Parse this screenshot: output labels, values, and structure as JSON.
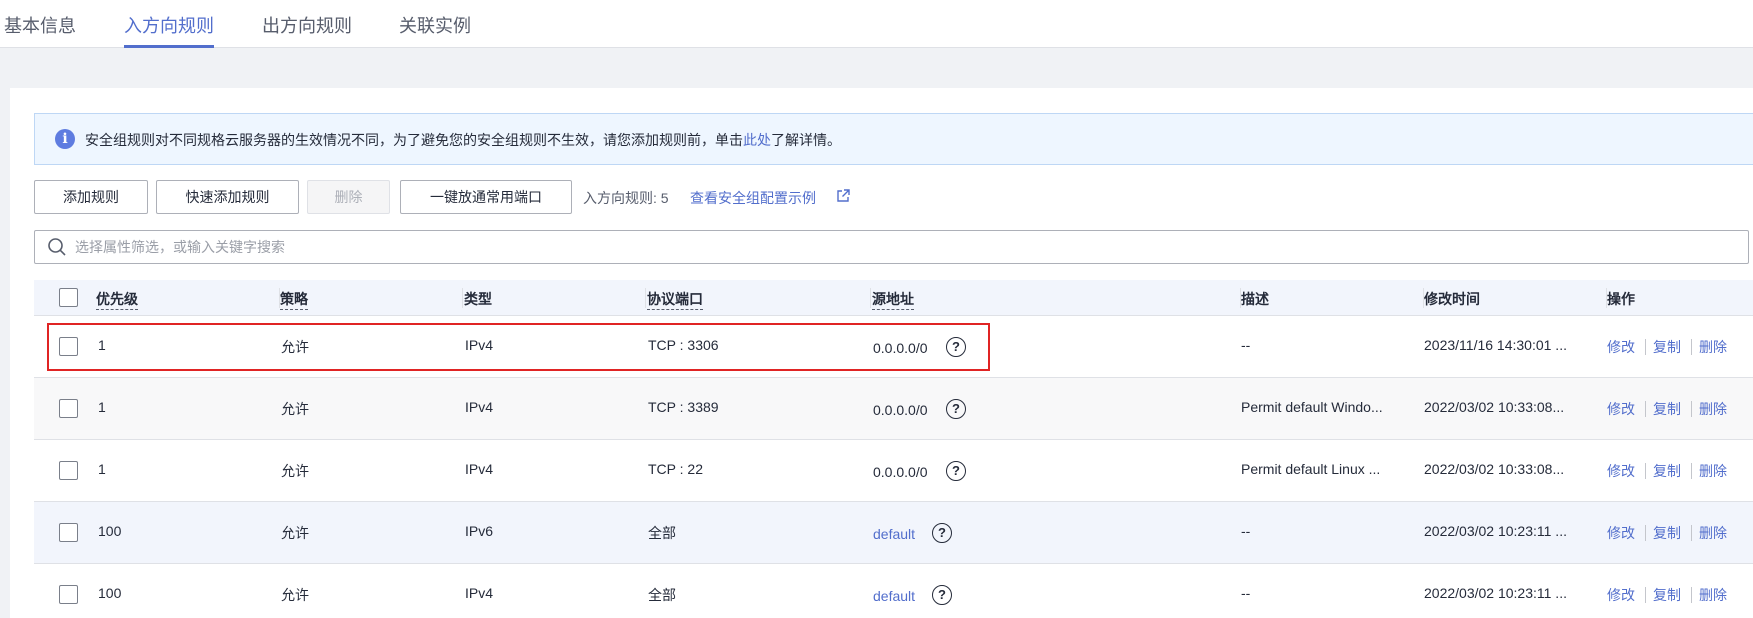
{
  "tabs": [
    {
      "label": "基本信息"
    },
    {
      "label": "入方向规则"
    },
    {
      "label": "出方向规则"
    },
    {
      "label": "关联实例"
    }
  ],
  "notice": {
    "icon": "info-icon",
    "text_before": "安全组规则对不同规格云服务器的生效情况不同，为了避免您的安全组规则不生效，请您添加规则前，单击",
    "link": "此处",
    "text_after": "了解详情。"
  },
  "toolbar": {
    "add_rule": "添加规则",
    "quick_add_rule": "快速添加规则",
    "delete": "删除",
    "open_common_ports": "一键放通常用端口",
    "rule_count": "入方向规则: 5",
    "config_example_link": "查看安全组配置示例"
  },
  "search": {
    "placeholder": "选择属性筛选，或输入关键字搜索"
  },
  "table": {
    "columns": {
      "priority": "优先级",
      "policy": "策略",
      "type": "类型",
      "protocol_port": "协议端口",
      "source": "源地址",
      "description": "描述",
      "modified": "修改时间",
      "actions": "操作"
    },
    "rows": [
      {
        "priority": "1",
        "policy": "允许",
        "type": "IPv4",
        "protocol_port": "TCP : 3306",
        "source": "0.0.0.0/0",
        "description": "--",
        "modified": "2023/11/16 14:30:01 ..."
      },
      {
        "priority": "1",
        "policy": "允许",
        "type": "IPv4",
        "protocol_port": "TCP : 3389",
        "source": "0.0.0.0/0",
        "description": "Permit default Windo...",
        "modified": "2022/03/02 10:33:08..."
      },
      {
        "priority": "1",
        "policy": "允许",
        "type": "IPv4",
        "protocol_port": "TCP : 22",
        "source": "0.0.0.0/0",
        "description": "Permit default Linux ...",
        "modified": "2022/03/02 10:33:08..."
      },
      {
        "priority": "100",
        "policy": "允许",
        "type": "IPv6",
        "protocol_port": "全部",
        "source": "default",
        "description": "--",
        "modified": "2022/03/02 10:23:11 ..."
      },
      {
        "priority": "100",
        "policy": "允许",
        "type": "IPv4",
        "protocol_port": "全部",
        "source": "default",
        "description": "--",
        "modified": "2022/03/02 10:23:11 ..."
      }
    ],
    "actions": {
      "edit": "修改",
      "copy": "复制",
      "delete": "删除"
    },
    "help_glyph": "?"
  },
  "colors": {
    "accent": "#526ecc",
    "highlight": "#e02424"
  }
}
